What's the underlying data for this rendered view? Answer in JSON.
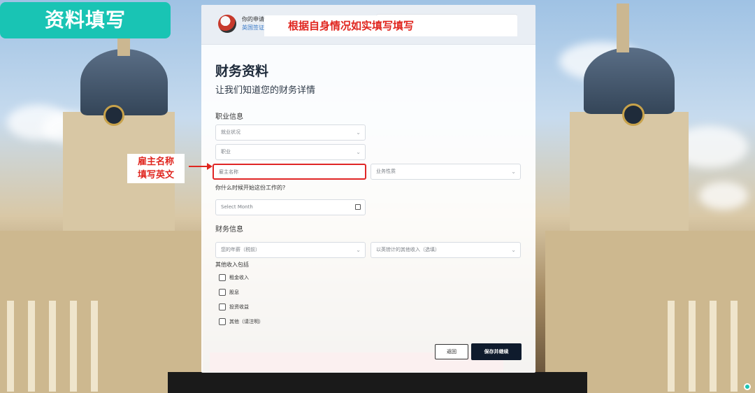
{
  "overlay": {
    "tag": "资料填写",
    "banner": "根据自身情况如实填写填写",
    "note_line1": "雇主名称",
    "note_line2": "填写英文"
  },
  "header": {
    "app_title": "你的申请",
    "app_subtitle": "英国签证"
  },
  "form": {
    "title": "财务资料",
    "subtitle": "让我们知道您的财务详情",
    "occupation_section": "职业信息",
    "employment_status": "就业状况",
    "occupation": "职业",
    "employer_name": "雇主名称",
    "business_nature": "业务性质",
    "start_question": "你什么时候开始这份工作的?",
    "start_month": "Select Month",
    "finance_section": "财务信息",
    "annual_salary": "您的年薪（税前）",
    "other_income_source": "以英镑计的其他收入（选填）",
    "other_income_label": "其他收入包括",
    "options": [
      "租金收入",
      "股息",
      "投资收益",
      "其他（请注明）"
    ],
    "back_button": "返回",
    "save_button": "保存并继续"
  },
  "colors": {
    "accent_teal": "#19c4b4",
    "highlight_red": "#e0261f",
    "primary_button": "#0f1b2d"
  }
}
